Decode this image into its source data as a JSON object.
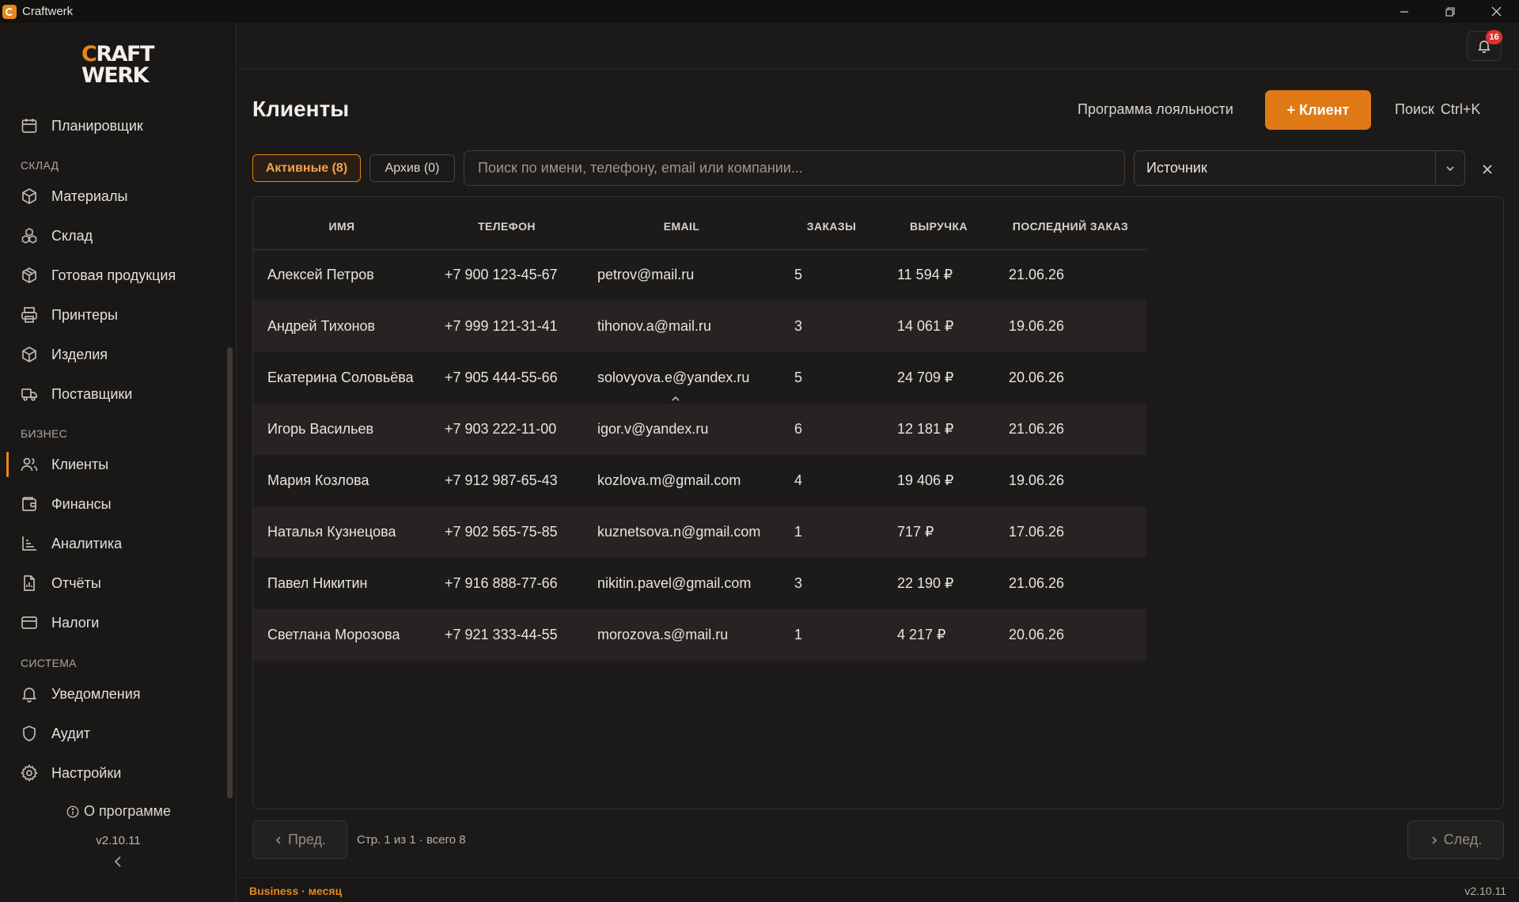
{
  "window": {
    "title": "Craftwerk"
  },
  "brand": {
    "line1": "RAFT",
    "line1_first": "C",
    "line2": "WERK"
  },
  "sidebar": {
    "planner": {
      "label": "Планировщик",
      "icon": "calendar-icon"
    },
    "sections": [
      {
        "title": "СКЛАД",
        "items": [
          {
            "label": "Материалы",
            "icon": "box-icon"
          },
          {
            "label": "Склад",
            "icon": "boxes-icon"
          },
          {
            "label": "Готовая продукция",
            "icon": "package-icon"
          },
          {
            "label": "Принтеры",
            "icon": "printer-icon"
          },
          {
            "label": "Изделия",
            "icon": "cube-icon"
          },
          {
            "label": "Поставщики",
            "icon": "truck-icon"
          }
        ]
      },
      {
        "title": "БИЗНЕС",
        "items": [
          {
            "label": "Клиенты",
            "icon": "users-icon",
            "active": true
          },
          {
            "label": "Финансы",
            "icon": "wallet-icon"
          },
          {
            "label": "Аналитика",
            "icon": "chart-icon"
          },
          {
            "label": "Отчёты",
            "icon": "report-icon"
          },
          {
            "label": "Налоги",
            "icon": "card-icon"
          }
        ]
      },
      {
        "title": "СИСТЕМА",
        "items": [
          {
            "label": "Уведомления",
            "icon": "bell-icon"
          },
          {
            "label": "Аудит",
            "icon": "shield-icon"
          },
          {
            "label": "Настройки",
            "icon": "gear-icon"
          }
        ]
      }
    ],
    "about": "О программе",
    "version": "v2.10.11"
  },
  "topbar": {
    "notifications_count": "16"
  },
  "page": {
    "title": "Клиенты",
    "loyalty_link": "Программа лояльности",
    "add_button": "+ Клиент",
    "search_hint": "Поиск",
    "search_shortcut": "Ctrl+K"
  },
  "filters": {
    "tab_active": "Активные (8)",
    "tab_archive": "Архив (0)",
    "search_placeholder": "Поиск по имени, телефону, email или компании...",
    "search_value": "",
    "source_value": "Источник"
  },
  "table": {
    "columns": [
      "ИМЯ",
      "ТЕЛЕФОН",
      "EMAIL",
      "ЗАКАЗЫ",
      "ВЫРУЧКА",
      "ПОСЛЕДНИЙ ЗАКАЗ"
    ],
    "rows": [
      {
        "name": "Алексей Петров",
        "phone": "+7 900 123-45-67",
        "email": "petrov@mail.ru",
        "orders": "5",
        "revenue": "11 594 ₽",
        "last": "21.06.26"
      },
      {
        "name": "Андрей Тихонов",
        "phone": "+7 999 121-31-41",
        "email": "tihonov.a@mail.ru",
        "orders": "3",
        "revenue": "14 061 ₽",
        "last": "19.06.26"
      },
      {
        "name": "Екатерина Соловьёва",
        "phone": "+7 905 444-55-66",
        "email": "solovyova.e@yandex.ru",
        "orders": "5",
        "revenue": "24 709 ₽",
        "last": "20.06.26"
      },
      {
        "name": "Игорь Васильев",
        "phone": "+7 903 222-11-00",
        "email": "igor.v@yandex.ru",
        "orders": "6",
        "revenue": "12 181 ₽",
        "last": "21.06.26"
      },
      {
        "name": "Мария Козлова",
        "phone": "+7 912 987-65-43",
        "email": "kozlova.m@gmail.com",
        "orders": "4",
        "revenue": "19 406 ₽",
        "last": "19.06.26"
      },
      {
        "name": "Наталья Кузнецова",
        "phone": "+7 902 565-75-85",
        "email": "kuznetsova.n@gmail.com",
        "orders": "1",
        "revenue": "717 ₽",
        "last": "17.06.26"
      },
      {
        "name": "Павел Никитин",
        "phone": "+7 916 888-77-66",
        "email": "nikitin.pavel@gmail.com",
        "orders": "3",
        "revenue": "22 190 ₽",
        "last": "21.06.26"
      },
      {
        "name": "Светлана Морозова",
        "phone": "+7 921 333-44-55",
        "email": "morozova.s@mail.ru",
        "orders": "1",
        "revenue": "4 217 ₽",
        "last": "20.06.26"
      }
    ]
  },
  "pagination": {
    "prev": "Пред.",
    "next": "След.",
    "info": "Стр. 1 из 1 · всего 8"
  },
  "status": {
    "plan": "Business · месяц",
    "version": "v2.10.11"
  },
  "colors": {
    "accent": "#e08219",
    "badge": "#d9342b",
    "background": "#1c1a19"
  }
}
